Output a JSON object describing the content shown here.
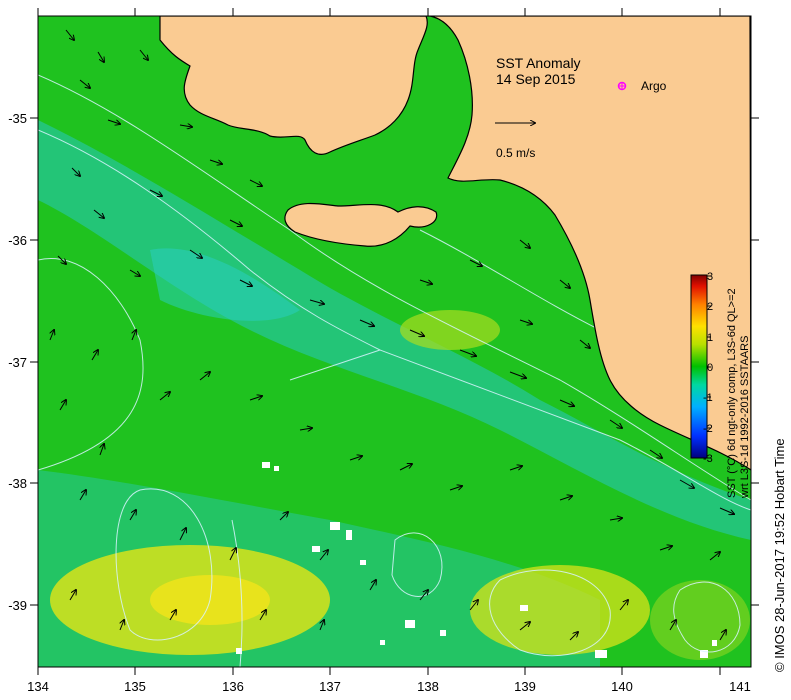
{
  "map": {
    "title": "SST Anomaly",
    "date": "14 Sep 2015",
    "argo_label": "Argo",
    "vector_scale_label": "0.5 m/s",
    "lon_ticks": [
      "134",
      "135",
      "136",
      "137",
      "138",
      "139",
      "140",
      "141"
    ],
    "lat_ticks": [
      "-35",
      "-36",
      "-37",
      "-38",
      "-39"
    ],
    "lon_range": [
      134,
      141.3
    ],
    "lat_range": [
      -34.2,
      -39.5
    ],
    "colors": {
      "land": "#facb92",
      "ocean_base": "#1fc21f",
      "anomaly_cool": "#27c9c0",
      "anomaly_warm": "#d8e31a",
      "argo_marker": "#ff00ff",
      "contour": "#d9f3ff"
    }
  },
  "colorbar": {
    "ticks": [
      "3",
      "2",
      "1",
      "0",
      "-1",
      "-2",
      "-3"
    ],
    "label_line1": "SST (°C) 6d ngt-only comp, L3S-6d QL>=2",
    "label_line2": "wrt L3S-1d 1992-2016 SSTAARS",
    "range": [
      -3,
      3
    ]
  },
  "credit": "© IMOS 28-Jun-2017 19:52 Hobart Time"
}
